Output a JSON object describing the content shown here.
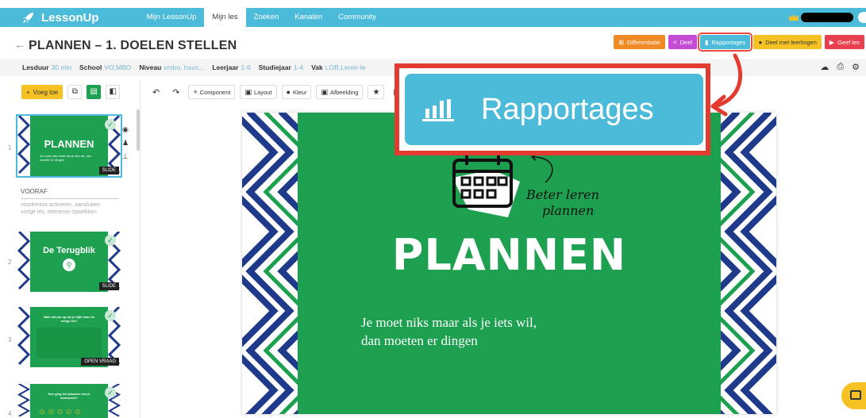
{
  "app": {
    "logo_text": "LessonUp",
    "nav": [
      "Mijn LessonUp",
      "Mijn les",
      "Zoeken",
      "Kanalen",
      "Community"
    ],
    "active_nav": "Mijn les"
  },
  "lesson": {
    "title": "PLANNEN – 1. DOELEN STELLEN",
    "buttons": {
      "differentiatie": "Differentiatie",
      "deel": "Deel",
      "rapportages": "Rapportages",
      "deel_met_leerlingen": "Deel met leerlingen",
      "geef_les": "Geef les"
    }
  },
  "meta": {
    "lesduur_label": "Lesduur",
    "lesduur_value": "30 min",
    "school_label": "School",
    "school_value": "VO,MBO",
    "niveau_label": "Niveau",
    "niveau_value": "vmbo, havo...",
    "leerjaar_label": "Leerjaar",
    "leerjaar_value": "1-6",
    "studiejaar_label": "Studiejaar",
    "studiejaar_value": "1-4",
    "vak_label": "Vak",
    "vak_value": "LOB,Leren-le"
  },
  "left_toolbar": {
    "voeg_toe": "Voeg toe"
  },
  "editor_toolbar": {
    "component": "Component",
    "layout": "Layout",
    "kleur": "Kleur",
    "afbeelding": "Afbeelding"
  },
  "sidebar": {
    "slides": [
      {
        "num": "1",
        "title": "PLANNEN",
        "subtitle": "Je moet niks maar als je iets wil, dan moeten er dingen",
        "tag": "SLIDE"
      },
      {
        "num": "2",
        "title": "De Terugblik",
        "tag": "SLIDE"
      },
      {
        "num": "3",
        "title": "Wat valt jou op als je kijkt naar de vorige les?",
        "tag": "OPEN VRAAG"
      },
      {
        "num": "4",
        "title": "Hoe ging het plannen van je toetsweek?"
      }
    ],
    "section_title": "VOORAF",
    "section_desc": "voorkennis activeren, aansluiten vorige les, interesse opwekken"
  },
  "slide": {
    "title": "PLANNEN",
    "script_text_1": "Beter leren",
    "script_text_2": "plannen",
    "quote_line1": "Je moet niks maar als je iets wil,",
    "quote_line2": "dan moeten er dingen"
  },
  "callout": {
    "label": "Rapportages"
  },
  "colors": {
    "brand": "#4bbbd9",
    "slide_green": "#1da04f",
    "highlight_red": "#e43b30",
    "wave_blue": "#1f3a8a"
  }
}
